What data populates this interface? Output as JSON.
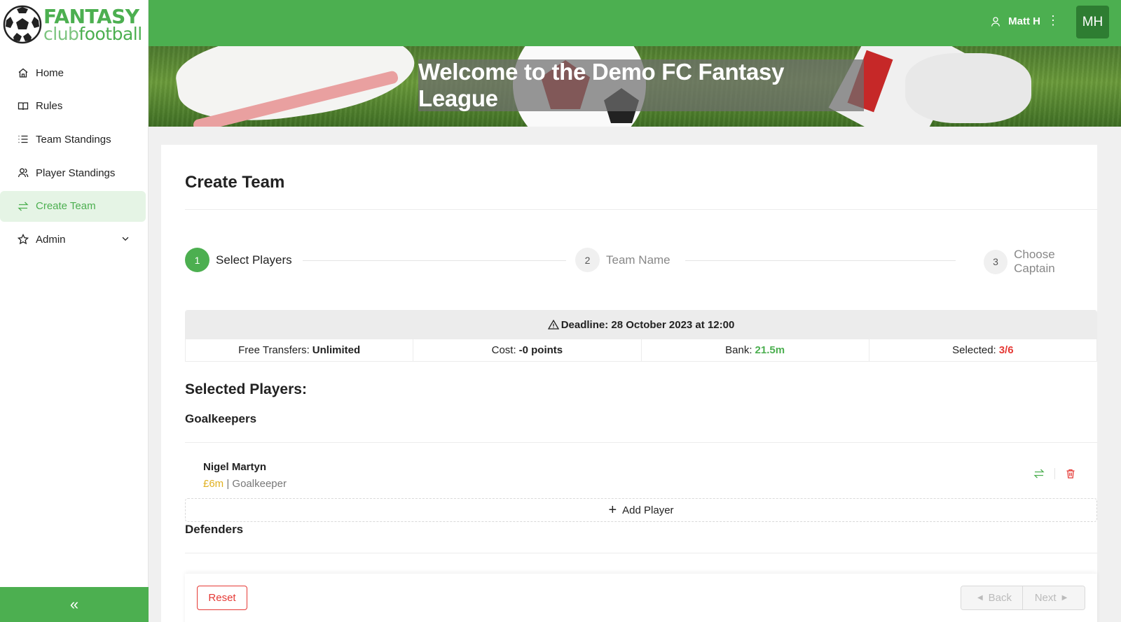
{
  "logo": {
    "line1": "FANTASY",
    "line2_a": "club",
    "line2_b": "football"
  },
  "nav": {
    "items": [
      {
        "label": "Home",
        "icon": "home-icon"
      },
      {
        "label": "Rules",
        "icon": "book-icon"
      },
      {
        "label": "Team Standings",
        "icon": "list-icon"
      },
      {
        "label": "Player Standings",
        "icon": "users-icon"
      },
      {
        "label": "Create Team",
        "icon": "swap-icon",
        "active": true
      },
      {
        "label": "Admin",
        "icon": "star-icon",
        "expandable": true
      }
    ],
    "collapse_label": "«"
  },
  "topbar": {
    "user_name": "Matt H",
    "avatar_initials": "MH"
  },
  "banner": {
    "title": "Welcome to the Demo FC Fantasy League"
  },
  "page": {
    "title": "Create Team"
  },
  "steps": [
    {
      "number": "1",
      "label": "Select Players",
      "active": true
    },
    {
      "number": "2",
      "label": "Team Name"
    },
    {
      "number": "3",
      "label": "Choose Captain"
    }
  ],
  "deadline": {
    "text": "Deadline: 28 October 2023 at 12:00"
  },
  "stats": {
    "free_transfers_label": "Free Transfers:",
    "free_transfers_value": "Unlimited",
    "cost_label": "Cost:",
    "cost_value": "-0 points",
    "bank_label": "Bank:",
    "bank_value": "21.5m",
    "selected_label": "Selected:",
    "selected_value": "3/6"
  },
  "selected": {
    "title": "Selected Players:",
    "goalkeepers_title": "Goalkeepers",
    "defenders_title": "Defenders",
    "players": [
      {
        "name": "Nigel Martyn",
        "price": "£6m",
        "separator": " | ",
        "position": "Goalkeeper"
      }
    ],
    "add_player_label": "Add Player"
  },
  "footer": {
    "reset_label": "Reset",
    "back_label": "Back",
    "next_label": "Next"
  },
  "colors": {
    "brand": "#4caf50",
    "danger": "#e53935",
    "price": "#e0b020"
  }
}
